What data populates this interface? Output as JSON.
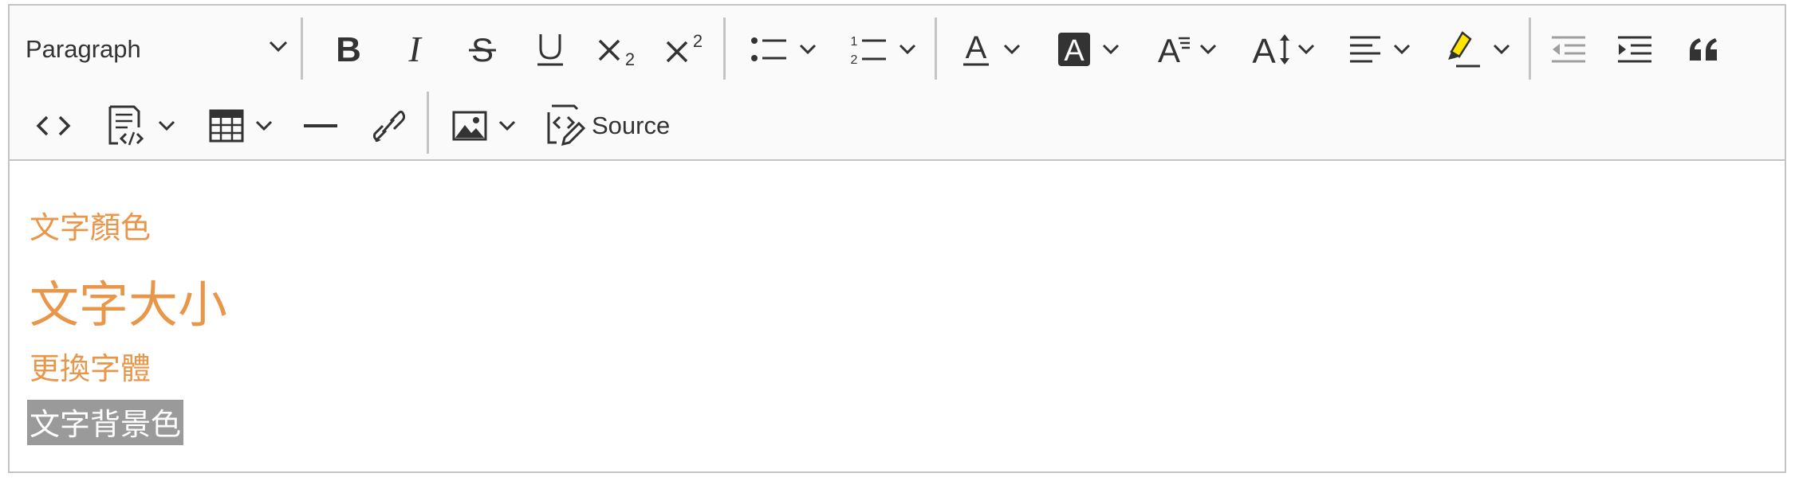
{
  "toolbar": {
    "heading_select": {
      "value": "Paragraph",
      "icon": "chevron-down-icon"
    },
    "row1": [
      {
        "name": "bold-button",
        "icon": "bold-icon"
      },
      {
        "name": "italic-button",
        "icon": "italic-icon"
      },
      {
        "name": "strikethrough-button",
        "icon": "strikethrough-icon"
      },
      {
        "name": "underline-button",
        "icon": "underline-icon"
      },
      {
        "name": "subscript-button",
        "icon": "subscript-icon"
      },
      {
        "name": "superscript-button",
        "icon": "superscript-icon"
      },
      {
        "name": "bulleted-list-button",
        "icon": "bulleted-list-icon",
        "dropdown": true
      },
      {
        "name": "numbered-list-button",
        "icon": "numbered-list-icon",
        "dropdown": true
      },
      {
        "name": "font-color-button",
        "icon": "font-color-icon",
        "dropdown": true
      },
      {
        "name": "font-background-color-button",
        "icon": "font-background-color-icon",
        "dropdown": true
      },
      {
        "name": "font-family-button",
        "icon": "font-family-icon",
        "dropdown": true
      },
      {
        "name": "font-size-button",
        "icon": "font-size-icon",
        "dropdown": true
      },
      {
        "name": "alignment-button",
        "icon": "align-left-icon",
        "dropdown": true
      },
      {
        "name": "highlight-button",
        "icon": "highlighter-icon",
        "dropdown": true,
        "color": "#ffe600"
      },
      {
        "name": "outdent-button",
        "icon": "outdent-icon",
        "disabled": true
      },
      {
        "name": "indent-button",
        "icon": "indent-icon"
      },
      {
        "name": "block-quote-button",
        "icon": "quote-icon"
      }
    ],
    "row2": [
      {
        "name": "code-button",
        "icon": "code-icon"
      },
      {
        "name": "code-block-button",
        "icon": "code-block-icon",
        "dropdown": true
      },
      {
        "name": "insert-table-button",
        "icon": "table-icon",
        "dropdown": true
      },
      {
        "name": "horizontal-line-button",
        "icon": "horizontal-line-icon"
      },
      {
        "name": "link-button",
        "icon": "link-icon"
      },
      {
        "name": "insert-image-button",
        "icon": "image-icon",
        "dropdown": true
      },
      {
        "name": "source-button",
        "icon": "source-edit-icon"
      }
    ],
    "source_label": "Source"
  },
  "content": {
    "lines": [
      {
        "text": "文字顏色",
        "color": "#e8964a"
      },
      {
        "text": "文字大小",
        "color": "#e8964a"
      },
      {
        "text": "更換字體",
        "color": "#e8964a"
      },
      {
        "text": "文字背景色",
        "color": "#ffffff",
        "background": "#9a9a9a"
      }
    ]
  },
  "colors": {
    "icon": "#333333",
    "icon_disabled": "#9e9e9e",
    "toolbar_bg": "#fafafa",
    "border": "#c4c4c4",
    "accent_text": "#e8964a",
    "highlight_yellow": "#ffe600"
  }
}
